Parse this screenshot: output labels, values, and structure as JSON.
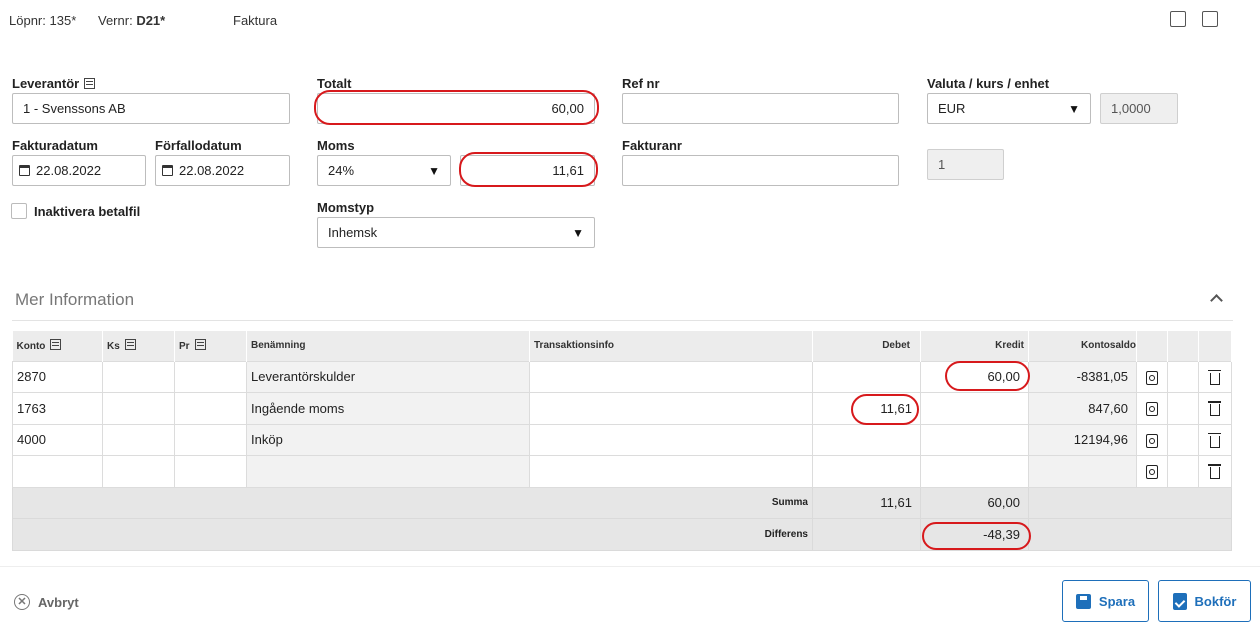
{
  "header": {
    "lopnr_label": "Löpnr:",
    "lopnr_value": "135*",
    "vernr_label": "Vernr:",
    "vernr_value": "D21*",
    "doc_type": "Faktura",
    "icons": [
      "calendar-swap-icon",
      "image-icon"
    ]
  },
  "form": {
    "leverantor_label": "Leverantör",
    "leverantor_value": "1 - Svenssons AB",
    "totalt_label": "Totalt",
    "totalt_value": "60,00",
    "refnr_label": "Ref nr",
    "refnr_value": "",
    "valuta_label": "Valuta / kurs / enhet",
    "valuta_value": "EUR",
    "kurs_value": "1,0000",
    "enhet_value": "1",
    "fakturadatum_label": "Fakturadatum",
    "fakturadatum_value": "22.08.2022",
    "forfallodatum_label": "Förfallodatum",
    "forfallodatum_value": "22.08.2022",
    "moms_label": "Moms",
    "moms_value": "24%",
    "moms_amount": "11,61",
    "fakturanr_label": "Fakturanr",
    "fakturanr_value": "",
    "inaktivera_label": "Inaktivera betalfil",
    "momstyp_label": "Momstyp",
    "momstyp_value": "Inhemsk"
  },
  "section": {
    "title": "Mer Information"
  },
  "table": {
    "headers": {
      "konto": "Konto",
      "ks": "Ks",
      "pr": "Pr",
      "benamning": "Benämning",
      "transaktionsinfo": "Transaktionsinfo",
      "debet": "Debet",
      "kredit": "Kredit",
      "kontosaldo": "Kontosaldo"
    },
    "rows": [
      {
        "konto": "2870",
        "ks": "",
        "pr": "",
        "benamning": "Leverantörskulder",
        "info": "",
        "debet": "",
        "kredit": "60,00",
        "saldo": "-8381,05"
      },
      {
        "konto": "1763",
        "ks": "",
        "pr": "",
        "benamning": "Ingående moms",
        "info": "",
        "debet": "11,61",
        "kredit": "",
        "saldo": "847,60"
      },
      {
        "konto": "4000",
        "ks": "",
        "pr": "",
        "benamning": "Inköp",
        "info": "",
        "debet": "",
        "kredit": "",
        "saldo": "12194,96"
      },
      {
        "konto": "",
        "ks": "",
        "pr": "",
        "benamning": "",
        "info": "",
        "debet": "",
        "kredit": "",
        "saldo": ""
      }
    ],
    "summa_label": "Summa",
    "summa_debet": "11,61",
    "summa_kredit": "60,00",
    "differens_label": "Differens",
    "differens_value": "-48,39"
  },
  "footer": {
    "cancel_label": "Avbryt",
    "save_label": "Spara",
    "book_label": "Bokför"
  },
  "colors": {
    "accent": "#1e6fba",
    "highlight": "#d7191c"
  }
}
